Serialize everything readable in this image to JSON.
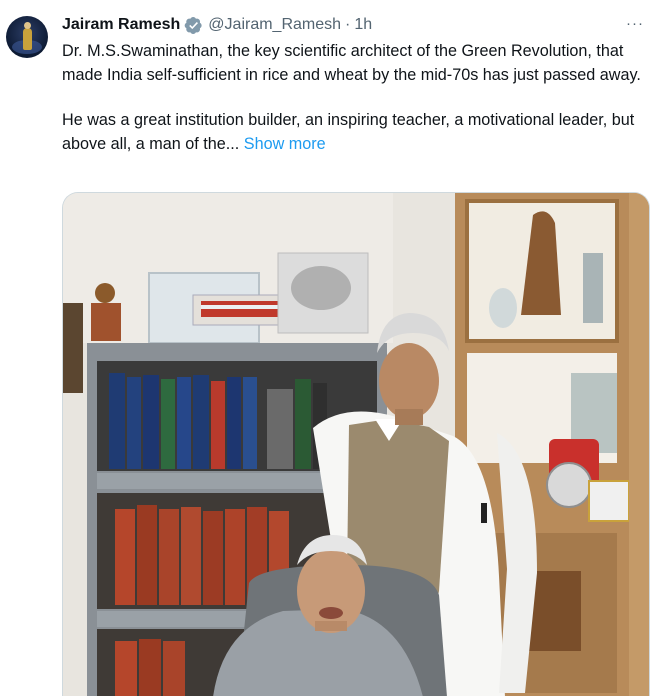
{
  "tweet": {
    "author_name": "Jairam Ramesh",
    "author_handle": "@Jairam_Ramesh",
    "separator": "·",
    "timestamp": "1h",
    "more_menu": "···",
    "paragraph1": "Dr. M.S.Swaminathan, the key scientific architect of the Green Revolution, that made India self-sufficient in rice and wheat by the mid-70s has just passed away.",
    "paragraph2": "He was a great institution builder, an inspiring teacher, a motivational leader,  but above all, a man of the...",
    "show_more_label": "Show more",
    "icons": {
      "verified": "verified-badge-icon",
      "more": "more-horizontal-icon"
    },
    "colors": {
      "link": "#1d9bf0",
      "secondary_text": "#536471",
      "primary_text": "#0f1419"
    }
  }
}
